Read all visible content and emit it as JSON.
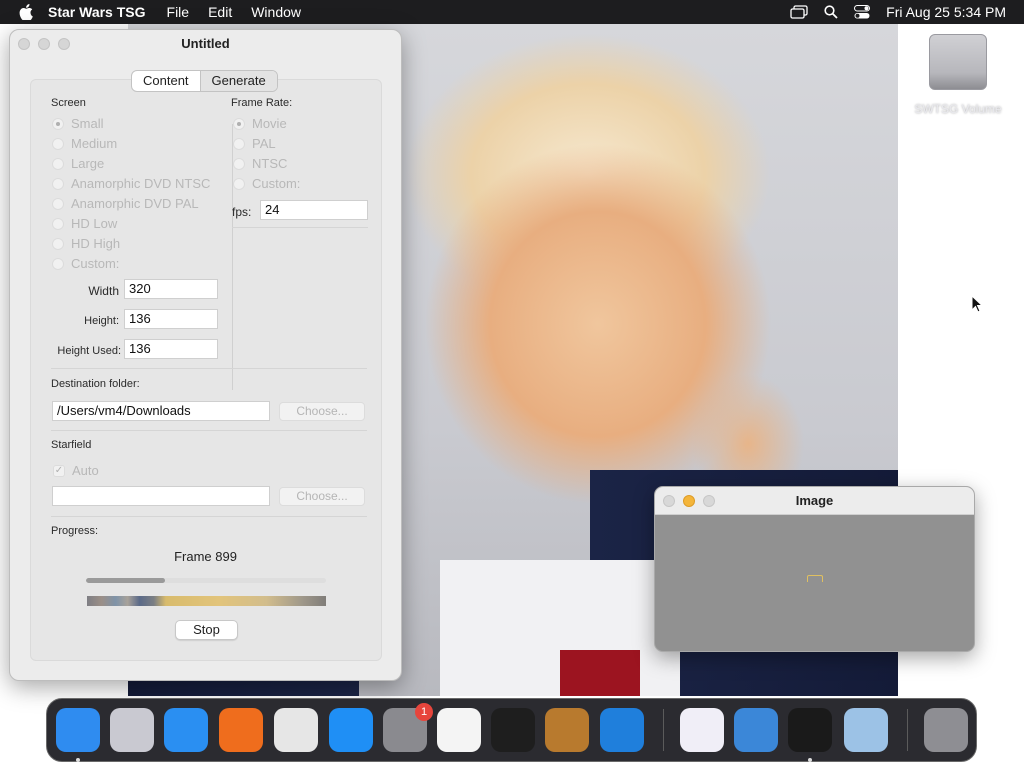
{
  "menubar": {
    "app_name": "Star Wars TSG",
    "menus": [
      "File",
      "Edit",
      "Window"
    ],
    "clock": "Fri Aug 25  5:34 PM"
  },
  "desktop": {
    "volume_label": "SWTSG Volume"
  },
  "main_window": {
    "title": "Untitled",
    "tabs": [
      {
        "label": "Content",
        "active": false
      },
      {
        "label": "Generate",
        "active": true
      }
    ],
    "screen": {
      "heading": "Screen",
      "options": [
        "Small",
        "Medium",
        "Large",
        "Anamorphic DVD NTSC",
        "Anamorphic DVD PAL",
        "HD Low",
        "HD High",
        "Custom:"
      ],
      "selected": "Small",
      "width_label": "Width",
      "width_value": "320",
      "height_label": "Height:",
      "height_value": "136",
      "height_used_label": "Height Used:",
      "height_used_value": "136"
    },
    "frame_rate": {
      "heading": "Frame Rate:",
      "options": [
        "Movie",
        "PAL",
        "NTSC",
        "Custom:"
      ],
      "selected": "Movie",
      "fps_label": "fps:",
      "fps_value": "24"
    },
    "destination": {
      "heading": "Destination folder:",
      "path": "/Users/vm4/Downloads",
      "choose_label": "Choose..."
    },
    "starfield": {
      "heading": "Starfield",
      "auto_label": "Auto",
      "auto_checked": true,
      "path": "",
      "choose_label": "Choose..."
    },
    "progress": {
      "heading": "Progress:",
      "frame_text": "Frame 899",
      "fraction": 0.33,
      "stop_label": "Stop"
    }
  },
  "image_window": {
    "title": "Image"
  },
  "dock": {
    "apps": [
      {
        "name": "finder",
        "color": "#2f8cf0",
        "running": true
      },
      {
        "name": "launchpad",
        "color": "#c9c9d1",
        "running": false
      },
      {
        "name": "safari",
        "color": "#2a8ff2",
        "running": false
      },
      {
        "name": "firefox",
        "color": "#ef6d1d",
        "running": false
      },
      {
        "name": "chrome",
        "color": "#e6e6e6",
        "running": false
      },
      {
        "name": "app-store",
        "color": "#1f8ff5",
        "running": false
      },
      {
        "name": "system-settings",
        "color": "#8a8a8f",
        "running": false,
        "badge": "1"
      },
      {
        "name": "textedit",
        "color": "#f4f4f4",
        "running": false
      },
      {
        "name": "terminal",
        "color": "#1e1e1e",
        "running": false
      },
      {
        "name": "garageband",
        "color": "#b87a2e",
        "running": false
      },
      {
        "name": "vscode",
        "color": "#1f7fdc",
        "running": false
      },
      {
        "name": "visual-studio",
        "color": "#f0eef7",
        "running": false
      },
      {
        "name": "weather",
        "color": "#3b87d8",
        "running": false
      },
      {
        "name": "star-wars-tsg",
        "color": "#1a1a1a",
        "running": true
      },
      {
        "name": "preview",
        "color": "#9cc2e6",
        "running": false
      },
      {
        "name": "trash",
        "color": "#8e8e93",
        "running": false
      }
    ]
  }
}
